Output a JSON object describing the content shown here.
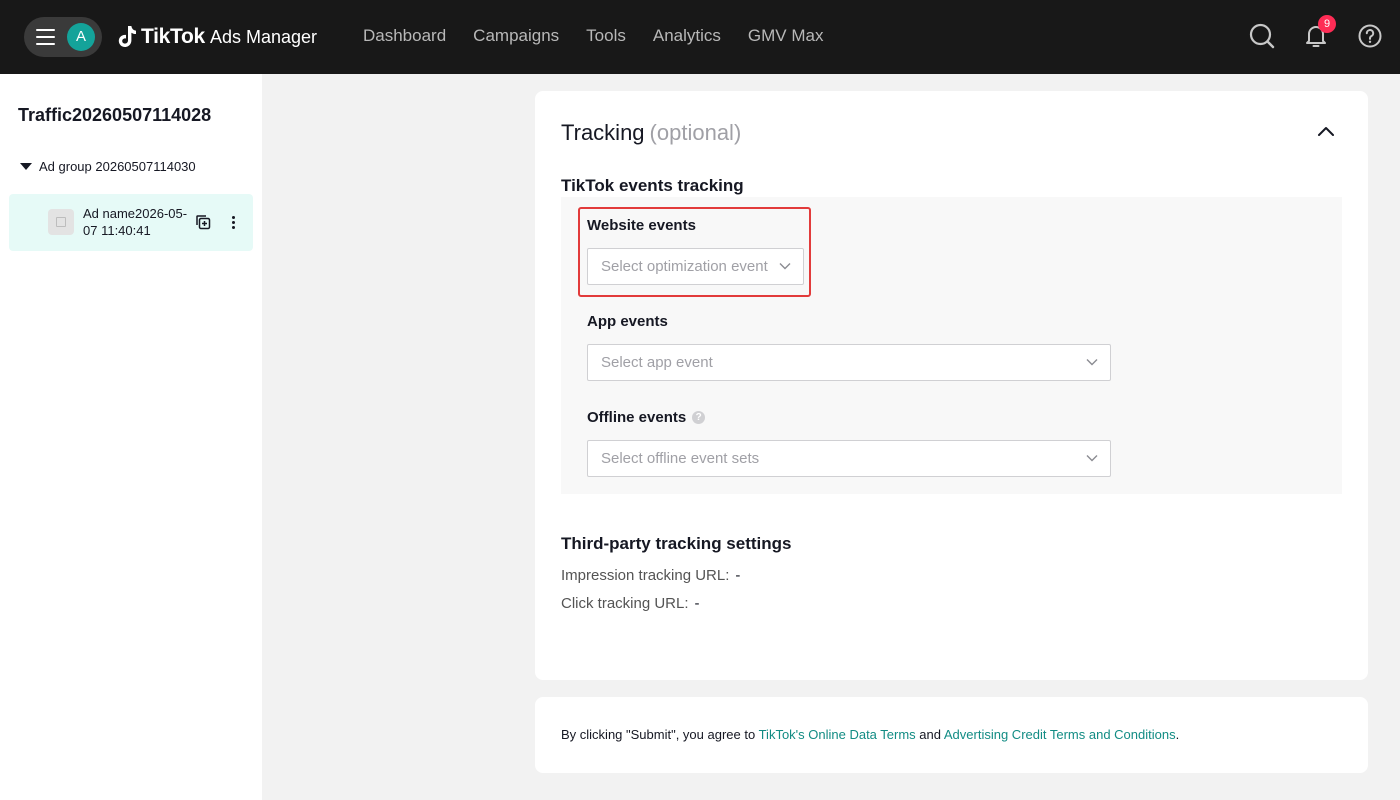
{
  "header": {
    "avatar_letter": "A",
    "brand_tiktok": "TikTok",
    "brand_product": "Ads Manager",
    "nav": [
      "Dashboard",
      "Campaigns",
      "Tools",
      "Analytics",
      "GMV Max"
    ],
    "notification_count": "9",
    "icons": [
      "menu-icon",
      "search-icon",
      "bell-icon",
      "help-icon"
    ]
  },
  "sidebar": {
    "campaign_name": "Traffic20260507114028",
    "ad_group_name": "Ad group 20260507114030",
    "ad_name": "Ad name2026-05-07 11:40:41"
  },
  "tracking": {
    "title": "Tracking",
    "title_suffix": "(optional)",
    "events_heading": "TikTok events tracking",
    "website_events_label": "Website events",
    "website_events_placeholder": "Select optimization event",
    "app_events_label": "App events",
    "app_events_placeholder": "Select app event",
    "offline_events_label": "Offline events",
    "offline_events_placeholder": "Select offline event sets",
    "third_party_heading": "Third-party tracking settings",
    "impression_label": "Impression tracking URL:",
    "impression_value": "-",
    "click_label": "Click tracking URL:",
    "click_value": "-"
  },
  "terms": {
    "prefix": "By clicking \"Submit\", you agree to ",
    "link1": "TikTok's Online Data Terms",
    "middle": " and ",
    "link2": "Advertising Credit Terms and Conditions",
    "suffix": "."
  },
  "colors": {
    "topbar": "#181818",
    "accent": "#128c84",
    "highlight_border": "#e23b3b",
    "selected_item": "#e6faf7",
    "badge": "#fe2c55"
  }
}
